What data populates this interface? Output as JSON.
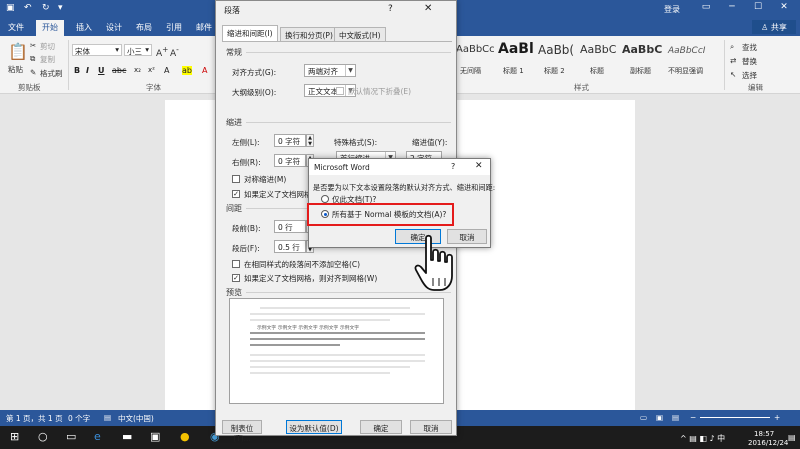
{
  "window": {
    "login": "登录",
    "share": "共享"
  },
  "ribbon": {
    "tabs": [
      "文件",
      "开始",
      "插入",
      "设计",
      "布局",
      "引用",
      "邮件"
    ],
    "clipboard": {
      "paste": "粘贴",
      "cut": "剪切",
      "copy": "复制",
      "format_painter": "格式刷",
      "group": "剪贴板"
    },
    "font": {
      "name": "宋体",
      "size": "小三",
      "group": "字体"
    },
    "styles": {
      "previews": [
        "AaBbCc",
        "AaBl",
        "AaBb(",
        "AaBbC",
        "AaBbC",
        "AaBbCcI"
      ],
      "names": [
        "无间隔",
        "标题 1",
        "标题 2",
        "标题",
        "副标题",
        "不明显强调"
      ],
      "group": "样式"
    },
    "editing": {
      "find": "查找",
      "replace": "替换",
      "select": "选择",
      "group": "编辑"
    }
  },
  "status": {
    "page": "第 1 页，共 1 页",
    "words": "0 个字",
    "lang": "中文(中国)"
  },
  "taskbar": {
    "time": "18:57",
    "date": "2016/12/24"
  },
  "paragraph_dialog": {
    "title": "段落",
    "help": "?",
    "tabs": [
      "缩进和间距(I)",
      "换行和分页(P)",
      "中文版式(H)"
    ],
    "general": {
      "heading": "常规",
      "alignment_label": "对齐方式(G):",
      "alignment_value": "两端对齐",
      "outline_label": "大纲级别(O):",
      "outline_value": "正文文本",
      "collapse": "默认情况下折叠(E)"
    },
    "indent": {
      "heading": "缩进",
      "left_label": "左侧(L):",
      "left_value": "0 字符",
      "right_label": "右侧(R):",
      "right_value": "0 字符",
      "special_label": "特殊格式(S):",
      "special_value": "首行缩进",
      "by_label": "缩进值(Y):",
      "by_value": "2 字符",
      "mirror": "对称缩进(M)",
      "auto_adjust": "如果定义了文档网格，则自动调整右缩进(D)"
    },
    "spacing": {
      "heading": "间距",
      "before_label": "段前(B):",
      "before_value": "0 行",
      "after_label": "段后(F):",
      "after_value": "0.5 行",
      "no_space": "在相同样式的段落间不添加空格(C)",
      "snap_grid": "如果定义了文档网格，则对齐到网格(W)"
    },
    "preview": {
      "heading": "预览",
      "sample_text": "示例文字 示例文字 示例文字 示例文字 示例文字"
    },
    "buttons": {
      "tabs": "制表位(T)...",
      "default": "设为默认值(D)",
      "ok": "确定",
      "cancel": "取消"
    }
  },
  "confirm_dialog": {
    "title": "Microsoft Word",
    "help": "?",
    "question": "是否要为以下文本设置段落的默认对齐方式、缩进和间距:",
    "option_1": "仅此文档(T)?",
    "option_2": "所有基于 Normal 模板的文档(A)?",
    "selected": 2,
    "ok": "确定",
    "cancel": "取消"
  },
  "colors": {
    "word_blue": "#2b579a",
    "highlight_red": "#e41b1b",
    "dialog_bg": "#f0f0f0",
    "focus_blue": "#0078d7"
  }
}
